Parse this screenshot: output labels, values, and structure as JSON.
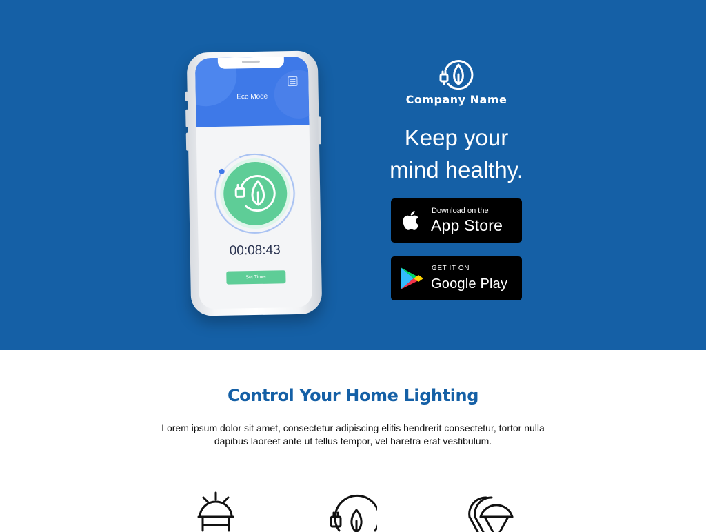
{
  "hero": {
    "background": "#1560a6",
    "phone": {
      "screen_title": "Eco Mode",
      "timer": "00:08:43",
      "timer_button": "Set Timer",
      "header_color": "#3e79e8",
      "accent_color": "#5ecd97",
      "leaf-plug-icon": "leaf-plug-icon"
    },
    "brand": {
      "logo_icon": "leaf-plug-icon",
      "company_name": "Company Name"
    },
    "tagline_line1": "Keep your",
    "tagline_line2": "mind healthy.",
    "app_store": {
      "small_text": "Download on the",
      "big_text": "App Store",
      "icon": "apple-icon"
    },
    "google_play": {
      "small_text": "GET IT ON",
      "big_text": "Google Play",
      "icon": "google-play-icon"
    }
  },
  "features": {
    "title": "Control Your Home Lighting",
    "title_color": "#1560a6",
    "description": "Lorem ipsum dolor sit amet, consectetur adipiscing elitis hendrerit consectetur, tortor nulla dapibus laoreet ante ut tellus tempor, vel haretra erat vestibulum.",
    "icons": [
      "alarm-light-icon",
      "leaf-plug-icon",
      "light-bulbs-icon"
    ]
  }
}
